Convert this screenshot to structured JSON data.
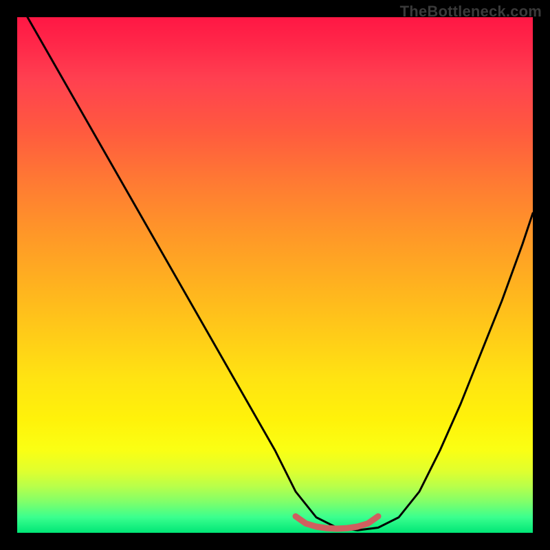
{
  "watermark": "TheBottleneck.com",
  "colors": {
    "curve_stroke": "#000000",
    "marker_stroke": "#cf5f5f",
    "background": "#000000"
  },
  "chart_data": {
    "type": "line",
    "title": "",
    "xlabel": "",
    "ylabel": "",
    "xlim": [
      0,
      100
    ],
    "ylim": [
      0,
      100
    ],
    "series": [
      {
        "name": "bottleneck-curve",
        "x": [
          2,
          6,
          10,
          14,
          18,
          22,
          26,
          30,
          34,
          38,
          42,
          46,
          50,
          54,
          58,
          62,
          66,
          70,
          74,
          78,
          82,
          86,
          90,
          94,
          98,
          100
        ],
        "y": [
          100,
          93,
          86,
          79,
          72,
          65,
          58,
          51,
          44,
          37,
          30,
          23,
          16,
          8,
          3,
          1,
          0.5,
          1,
          3,
          8,
          16,
          25,
          35,
          45,
          56,
          62
        ]
      },
      {
        "name": "optimal-range-marker",
        "x": [
          54,
          56,
          58,
          60,
          62,
          64,
          66,
          68,
          70
        ],
        "y": [
          3.2,
          1.8,
          1.2,
          0.9,
          0.8,
          0.9,
          1.2,
          1.8,
          3.2
        ]
      }
    ],
    "annotations": []
  }
}
